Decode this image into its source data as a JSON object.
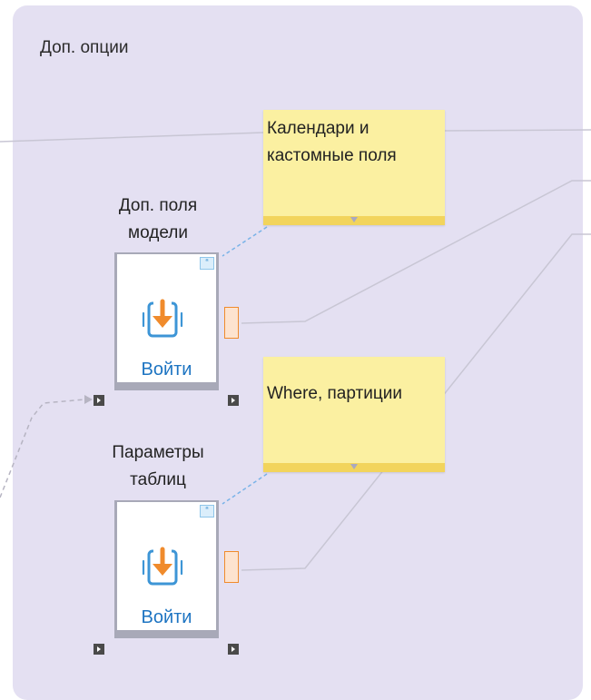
{
  "group": {
    "title": "Доп. опции"
  },
  "notes": [
    {
      "text": "Календари и кастомные поля"
    },
    {
      "text": "Where, партиции"
    }
  ],
  "nodes": [
    {
      "label": "Доп. поля модели",
      "caption": "Войти",
      "icon": "import-widget-icon"
    },
    {
      "label": "Параметры таблиц",
      "caption": "Войти",
      "icon": "import-widget-icon"
    }
  ],
  "colors": {
    "group_background": "#e4e0f2",
    "note_background": "#fbf0a1",
    "note_footer": "#f2d45c",
    "caption": "#1d74c2",
    "icon_arrow": "#f08b2c",
    "icon_frame": "#3d95d6"
  }
}
